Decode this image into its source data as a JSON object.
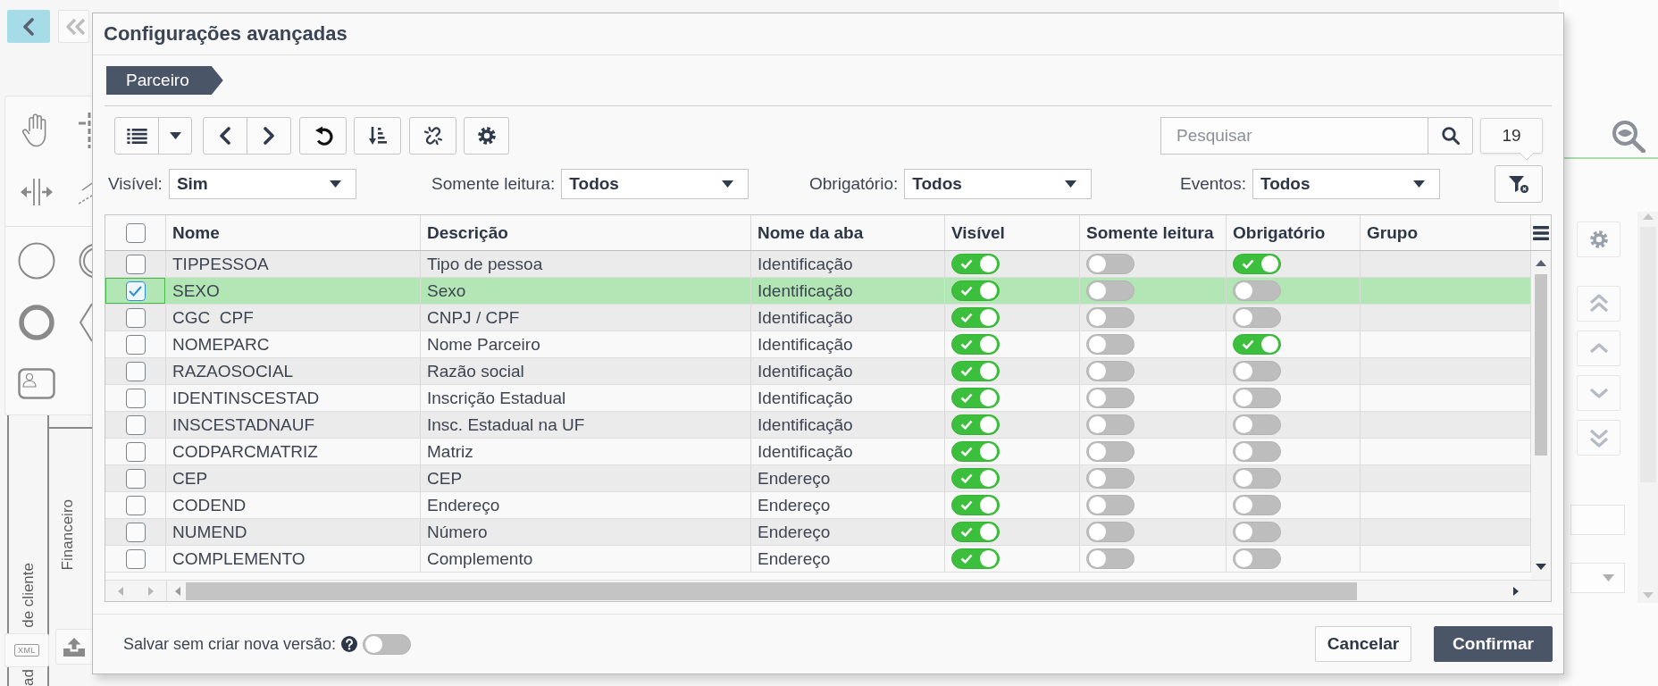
{
  "background": {
    "xml_button": "XML",
    "lane_labels": {
      "inner": "Financeiro",
      "outer": "de cliente",
      "outer_cut": "ad"
    }
  },
  "dialog": {
    "title": "Configurações avançadas",
    "breadcrumb": "Parceiro",
    "search": {
      "placeholder": "Pesquisar"
    },
    "record_count": "19",
    "filters": [
      {
        "label": "Visível:",
        "value": "Sim"
      },
      {
        "label": "Somente leitura:",
        "value": "Todos"
      },
      {
        "label": "Obrigatório:",
        "value": "Todos"
      },
      {
        "label": "Eventos:",
        "value": "Todos"
      }
    ],
    "table": {
      "select_all": {
        "checked": false
      },
      "columns": [
        "Nome",
        "Descrição",
        "Nome da aba",
        "Visível",
        "Somente leitura",
        "Obrigatório",
        "Grupo"
      ],
      "rows": [
        {
          "checked": false,
          "selected": false,
          "name": "TIPPESSOA",
          "description": "Tipo de pessoa",
          "tab": "Identificação",
          "visible": true,
          "read_only": false,
          "required": true
        },
        {
          "checked": true,
          "selected": true,
          "name": "SEXO",
          "description": "Sexo",
          "tab": "Identificação",
          "visible": true,
          "read_only": false,
          "required": false
        },
        {
          "checked": false,
          "selected": false,
          "name": "CGC  CPF",
          "description": "CNPJ / CPF",
          "tab": "Identificação",
          "visible": true,
          "read_only": false,
          "required": false
        },
        {
          "checked": false,
          "selected": false,
          "name": "NOMEPARC",
          "description": "Nome Parceiro",
          "tab": "Identificação",
          "visible": true,
          "read_only": false,
          "required": true
        },
        {
          "checked": false,
          "selected": false,
          "name": "RAZAOSOCIAL",
          "description": "Razão social",
          "tab": "Identificação",
          "visible": true,
          "read_only": false,
          "required": false
        },
        {
          "checked": false,
          "selected": false,
          "name": "IDENTINSCESTAD",
          "description": "Inscrição Estadual",
          "tab": "Identificação",
          "visible": true,
          "read_only": false,
          "required": false
        },
        {
          "checked": false,
          "selected": false,
          "name": "INSCESTADNAUF",
          "description": "Insc. Estadual na UF",
          "tab": "Identificação",
          "visible": true,
          "read_only": false,
          "required": false
        },
        {
          "checked": false,
          "selected": false,
          "name": "CODPARCMATRIZ",
          "description": "Matriz",
          "tab": "Identificação",
          "visible": true,
          "read_only": false,
          "required": false
        },
        {
          "checked": false,
          "selected": false,
          "name": "CEP",
          "description": "CEP",
          "tab": "Endereço",
          "visible": true,
          "read_only": false,
          "required": false
        },
        {
          "checked": false,
          "selected": false,
          "name": "CODEND",
          "description": "Endereço",
          "tab": "Endereço",
          "visible": true,
          "read_only": false,
          "required": false
        },
        {
          "checked": false,
          "selected": false,
          "name": "NUMEND",
          "description": "Número",
          "tab": "Endereço",
          "visible": true,
          "read_only": false,
          "required": false
        },
        {
          "checked": false,
          "selected": false,
          "name": "COMPLEMENTO",
          "description": "Complemento",
          "tab": "Endereço",
          "visible": true,
          "read_only": false,
          "required": false
        }
      ]
    },
    "footer": {
      "option_label": "Salvar sem criar nova versão:",
      "option_on": false,
      "buttons": [
        {
          "label": "Cancelar",
          "kind": "secondary"
        },
        {
          "label": "Confirmar",
          "kind": "primary"
        }
      ]
    }
  }
}
